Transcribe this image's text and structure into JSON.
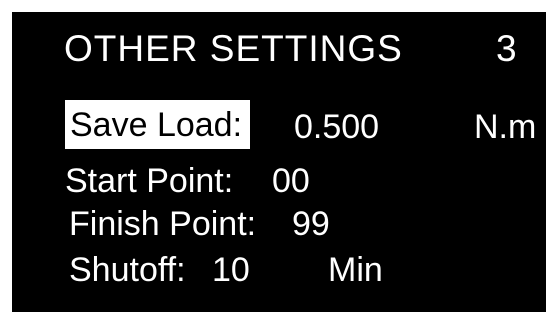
{
  "screen": {
    "title": "OTHER SETTINGS",
    "page_number": "3"
  },
  "settings": [
    {
      "label": "Save Load:",
      "value": "0.500",
      "unit": "N.m",
      "selected": true
    },
    {
      "label": "Start Point:",
      "value": "00",
      "unit": ""
    },
    {
      "label": "Finish Point:",
      "value": "99",
      "unit": ""
    },
    {
      "label": "Shutoff:",
      "value": "10",
      "unit": "Min"
    }
  ],
  "colors": {
    "background": "#000000",
    "text": "#ffffff",
    "highlight_bg": "#ffffff",
    "highlight_text": "#000000"
  }
}
